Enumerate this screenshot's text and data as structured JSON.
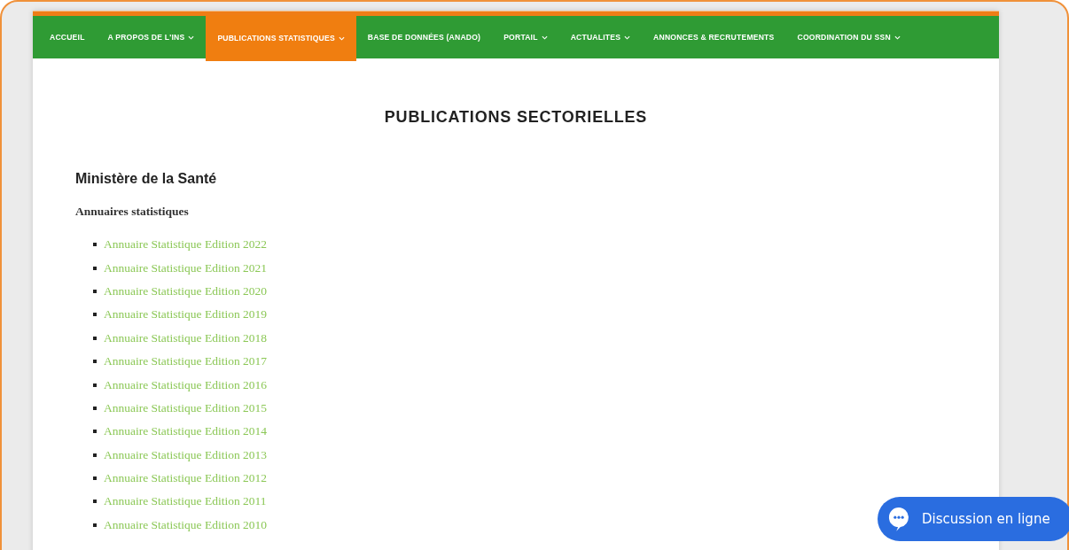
{
  "nav": [
    {
      "label": "ACCUEIL",
      "dropdown": false,
      "selected": false
    },
    {
      "label": "A PROPOS DE L'INS",
      "dropdown": true,
      "selected": false
    },
    {
      "label": "PUBLICATIONS STATISTIQUES",
      "dropdown": true,
      "selected": true
    },
    {
      "label": "BASE DE DONNÉES (ANADO)",
      "dropdown": false,
      "selected": false
    },
    {
      "label": "PORTAIL",
      "dropdown": true,
      "selected": false
    },
    {
      "label": "ACTUALITES",
      "dropdown": true,
      "selected": false
    },
    {
      "label": "ANNONCES & RECRUTEMENTS",
      "dropdown": false,
      "selected": false
    },
    {
      "label": "COORDINATION DU SSN",
      "dropdown": true,
      "selected": false
    }
  ],
  "page_title": "PUBLICATIONS SECTORIELLES",
  "section": {
    "title": "Ministère de la Santé",
    "subtitle": "Annuaires statistiques",
    "links": [
      "Annuaire Statistique Edition 2022",
      "Annuaire Statistique Edition 2021",
      "Annuaire Statistique Edition 2020",
      "Annuaire Statistique Edition 2019",
      "Annuaire Statistique Edition 2018",
      "Annuaire Statistique Edition 2017",
      "Annuaire Statistique Edition 2016",
      "Annuaire Statistique Edition 2015",
      "Annuaire Statistique Edition 2014",
      "Annuaire Statistique Edition 2013",
      "Annuaire Statistique Edition 2012",
      "Annuaire Statistique Edition 2011",
      "Annuaire Statistique Edition 2010"
    ]
  },
  "chat_button": {
    "label": "Discussion en ligne"
  }
}
